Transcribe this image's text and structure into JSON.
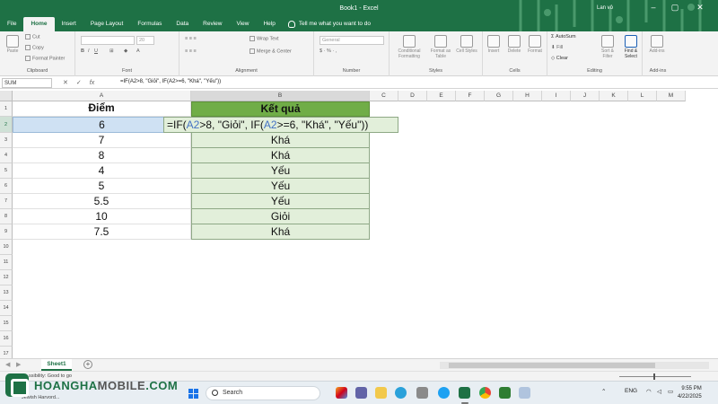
{
  "window": {
    "title": "Book1 - Excel",
    "user": "Lan vô"
  },
  "tabs": [
    "File",
    "Home",
    "Insert",
    "Page Layout",
    "Formulas",
    "Data",
    "Review",
    "View",
    "Help"
  ],
  "active_tab": "Home",
  "tell_me": "Tell me what you want to do",
  "ribbon": {
    "clipboard": {
      "paste": "Paste",
      "cut": "Cut",
      "copy": "Copy",
      "format_painter": "Format Painter",
      "label": "Clipboard"
    },
    "font": {
      "label": "Font",
      "size": "20"
    },
    "alignment": {
      "wrap": "Wrap Text",
      "merge": "Merge & Center",
      "label": "Alignment"
    },
    "number": {
      "format": "General",
      "label": "Number"
    },
    "styles": {
      "conditional": "Conditional Formatting",
      "format_table": "Format as Table",
      "cell_styles": "Cell Styles",
      "label": "Styles"
    },
    "cells": {
      "insert": "Insert",
      "delete": "Delete",
      "format": "Format",
      "label": "Cells"
    },
    "editing": {
      "autosum": "AutoSum",
      "fill": "Fill",
      "clear": "Clear",
      "sort": "Sort & Filter",
      "find": "Find & Select",
      "label": "Editing"
    },
    "addins": {
      "button": "Add-ins",
      "label": "Add-ins"
    }
  },
  "formula_bar": {
    "name_box": "SUM",
    "fx": "fx",
    "formula": "=IF(A2>8, \"Giỏi\", IF(A2>=6, \"Khá\", \"Yếu\"))"
  },
  "columns": [
    "A",
    "B",
    "C",
    "D",
    "E",
    "F",
    "G",
    "H",
    "I",
    "J",
    "K",
    "L",
    "M"
  ],
  "rows": [
    "1",
    "2",
    "3",
    "4",
    "5",
    "6",
    "7",
    "8",
    "9",
    "10",
    "11",
    "12",
    "13",
    "14",
    "15",
    "16",
    "17"
  ],
  "table": {
    "header_a": "Điểm",
    "header_b": "Kết quả",
    "scores": [
      "6",
      "7",
      "8",
      "4",
      "5",
      "5.5",
      "10",
      "7.5"
    ],
    "results": [
      "",
      "Khá",
      "Khá",
      "Yếu",
      "Yếu",
      "Yếu",
      "Giỏi",
      "Khá"
    ]
  },
  "editing_cell": {
    "p1": "=IF(",
    "ref1": "A2",
    "p2": ">8, \"Giỏi\", IF(",
    "ref2": "A2",
    "p3": ">=6, \"Khá\", \"Yếu\"))"
  },
  "sheet_tab": "Sheet1",
  "status": "ssibility: Good to go",
  "taskbar": {
    "search": "Search",
    "lang": "ENG",
    "time": "9:55 PM",
    "date": "4/22/2025",
    "weather_line": "Jewish Harvord..."
  },
  "logo": {
    "brand_a": "HOANGHA",
    "brand_b": "MOBILE",
    "suffix": ".COM"
  },
  "colors": {
    "excel_green": "#1e7145",
    "header_green": "#70ad47",
    "light_green": "#e2efda",
    "selection_blue": "#cfe1f3"
  }
}
